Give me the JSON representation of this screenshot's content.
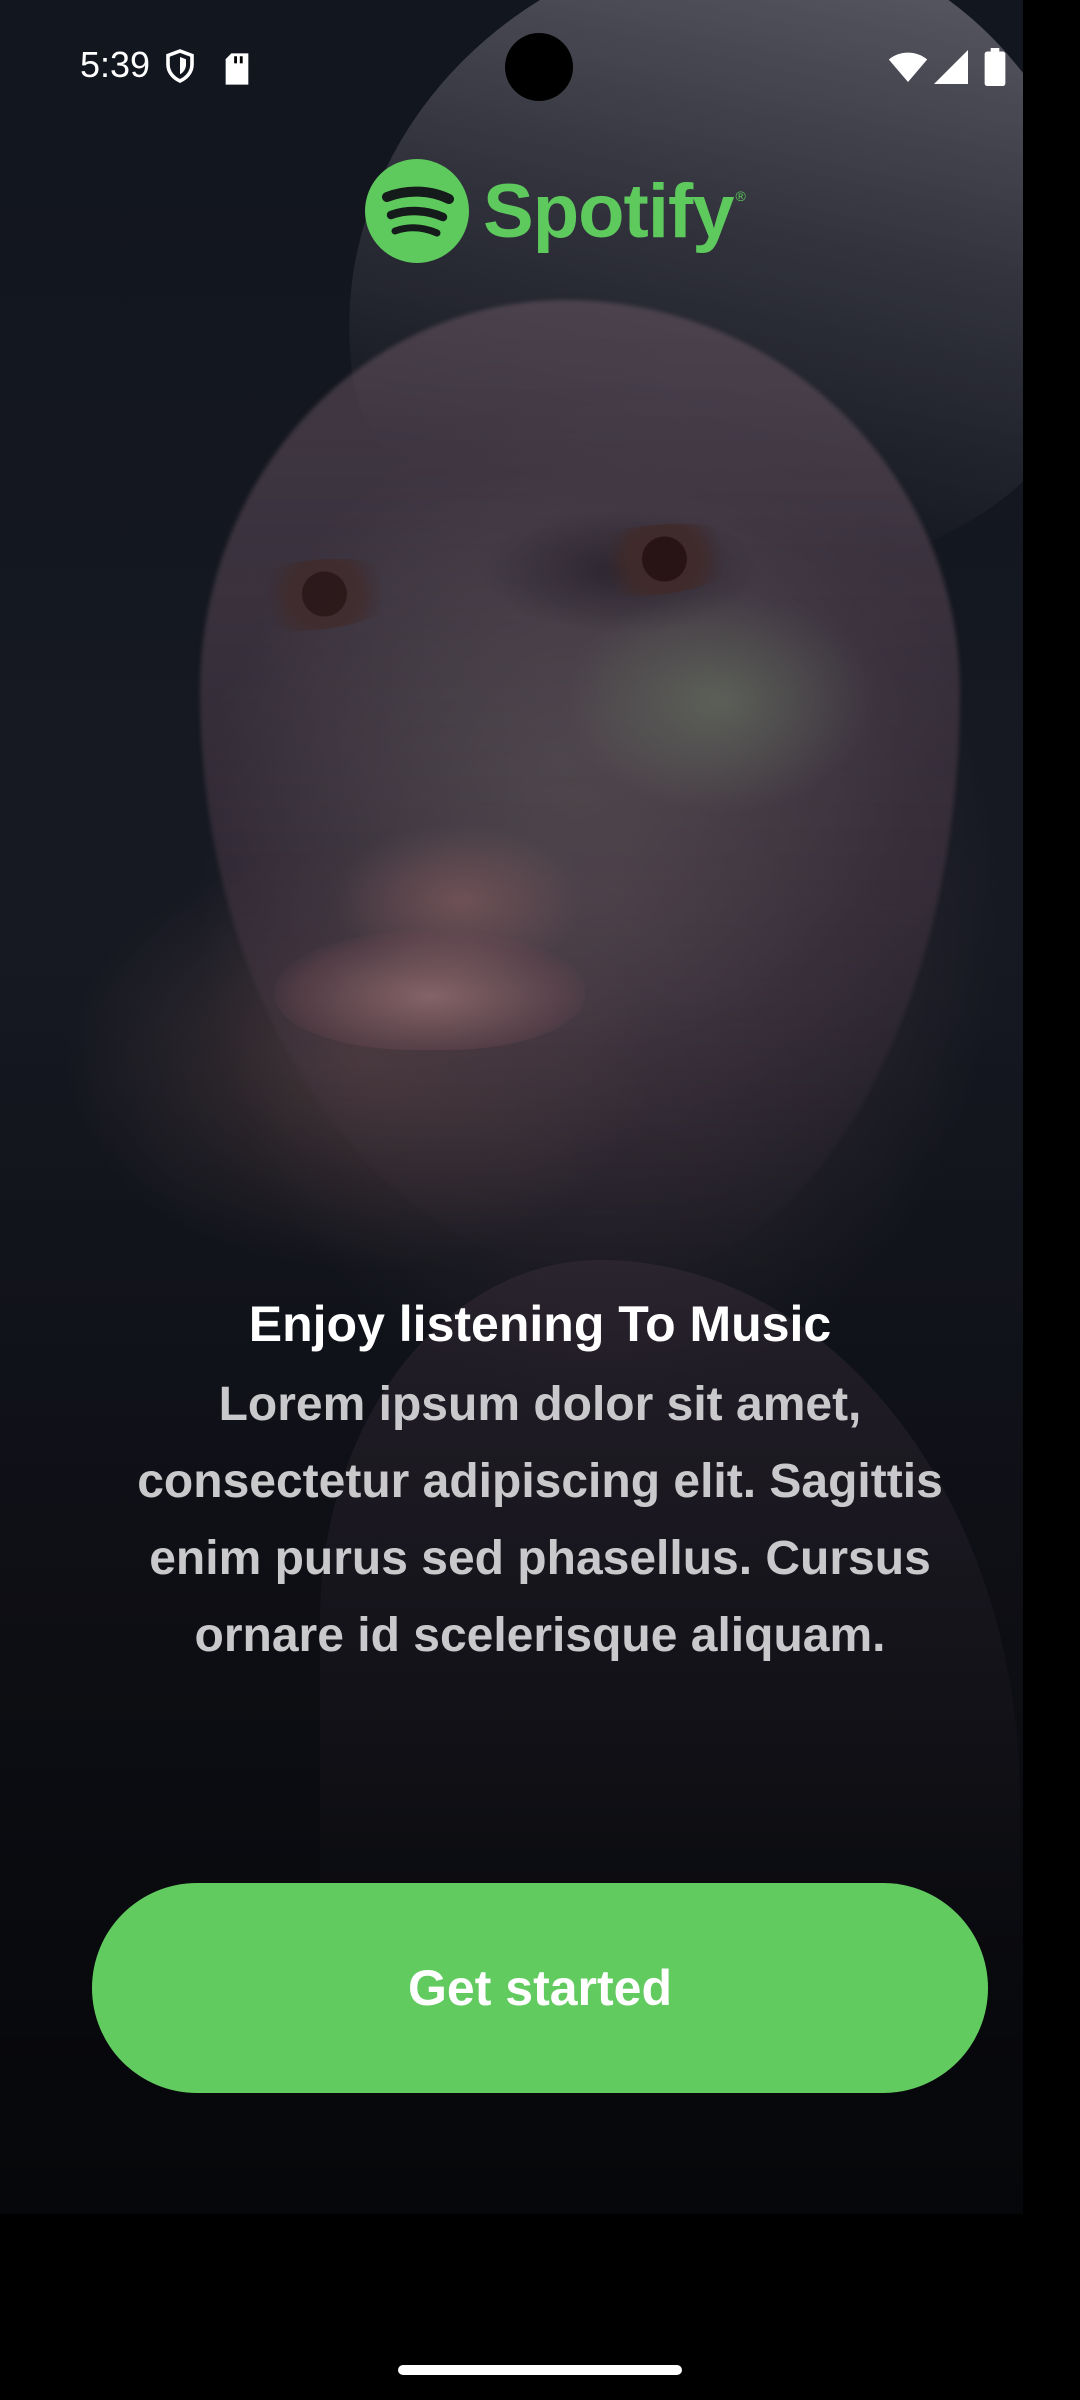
{
  "status_bar": {
    "time": "5:39",
    "icons": [
      "shield-icon",
      "sd-card-icon",
      "wifi-icon",
      "cell-signal-icon",
      "battery-icon"
    ]
  },
  "brand": {
    "name": "Spotify",
    "registered_mark": "®",
    "color": "#5ec95d"
  },
  "onboarding": {
    "headline": "Enjoy listening To Music",
    "body": "Lorem ipsum dolor sit amet, consectetur adipiscing elit. Sagittis enim purus sed phasellus. Cursus ornare id scelerisque aliquam."
  },
  "cta": {
    "label": "Get started",
    "color": "#62cb5f"
  }
}
